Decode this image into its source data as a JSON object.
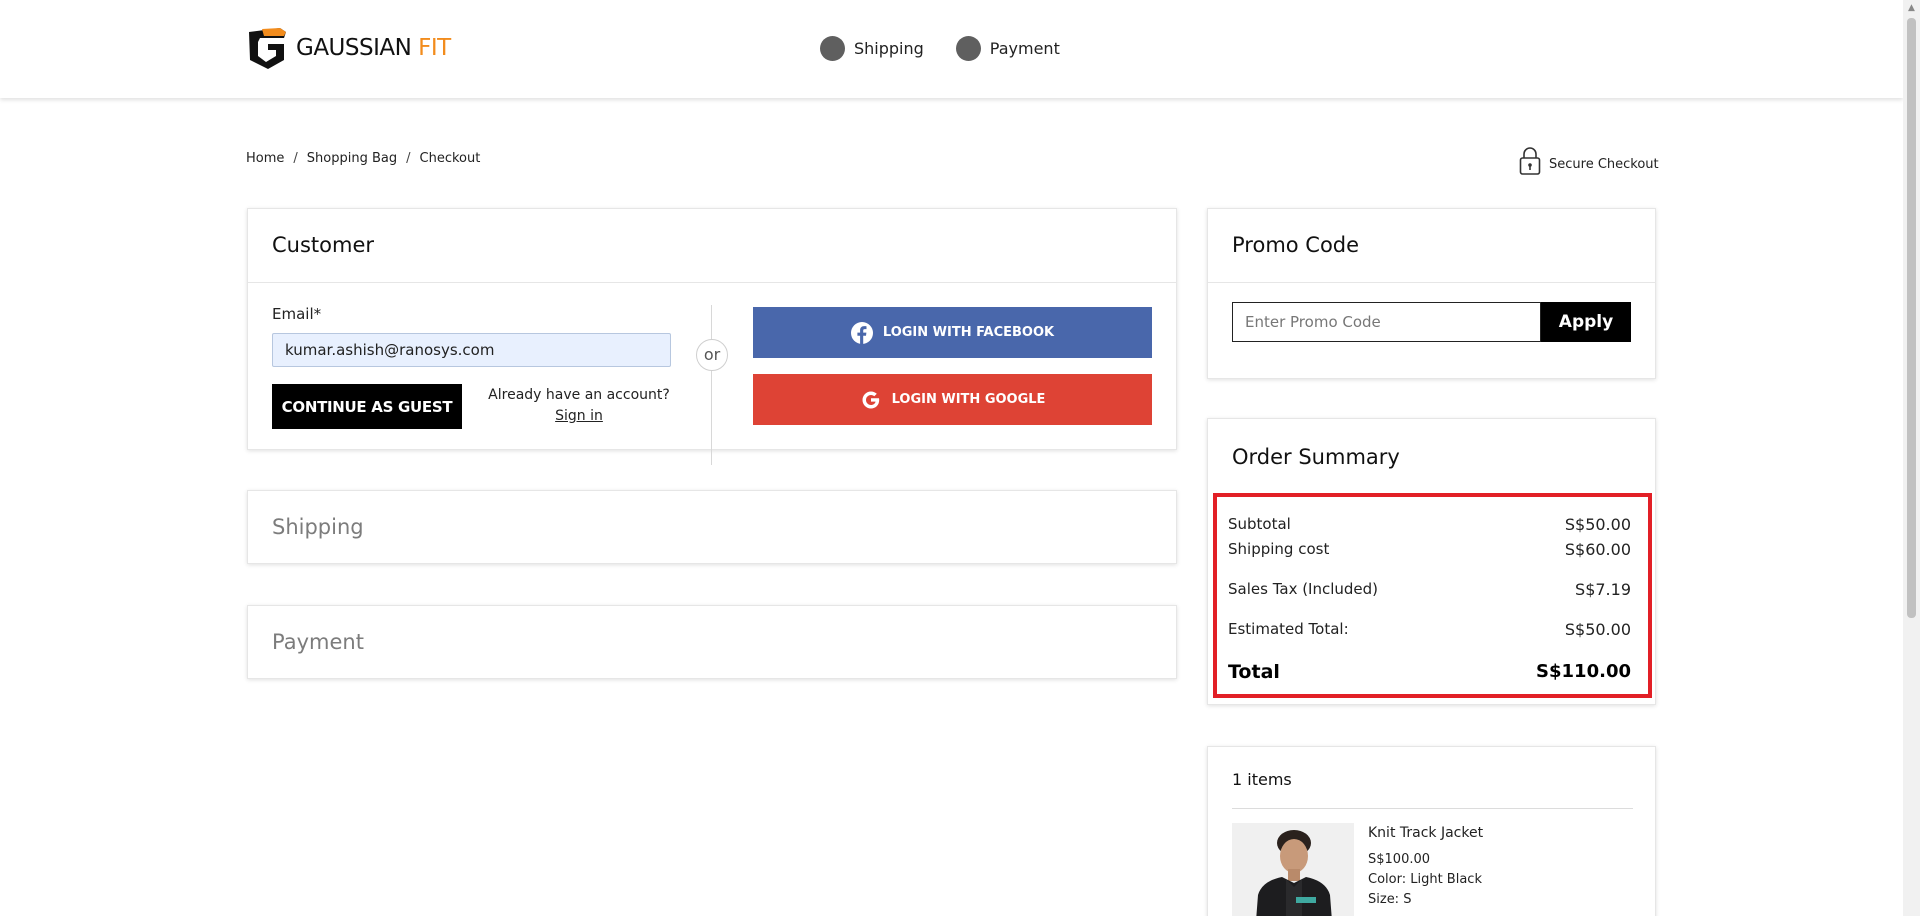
{
  "header": {
    "logo_text_main": "GAUSSIAN",
    "logo_text_accent": "FIT",
    "steps": [
      {
        "label": "Shipping"
      },
      {
        "label": "Payment"
      }
    ]
  },
  "breadcrumb": {
    "items": [
      "Home",
      "Shopping Bag",
      "Checkout"
    ],
    "separator": "/"
  },
  "secure": {
    "label": "Secure Checkout",
    "icon": "lock-icon"
  },
  "customer": {
    "title": "Customer",
    "email_label": "Email*",
    "email_value": "kumar.ashish@ranosys.com",
    "guest_button": "CONTINUE AS GUEST",
    "have_account": "Already have an account?",
    "sign_in": "Sign in",
    "or": "or",
    "facebook_button": "LOGIN WITH FACEBOOK",
    "google_button": "LOGIN WITH GOOGLE"
  },
  "shipping": {
    "title": "Shipping"
  },
  "payment": {
    "title": "Payment"
  },
  "promo": {
    "title": "Promo Code",
    "placeholder": "Enter Promo Code",
    "apply": "Apply"
  },
  "summary": {
    "title": "Order Summary",
    "rows": [
      {
        "label": "Subtotal",
        "value": "S$50.00"
      },
      {
        "label": "Shipping cost",
        "value": "S$60.00"
      },
      {
        "label": "Sales Tax (Included)",
        "value": "S$7.19"
      },
      {
        "label": "Estimated Total:",
        "value": "S$50.00"
      }
    ],
    "total_label": "Total",
    "total_value": "S$110.00"
  },
  "items": {
    "count_label": "1 items",
    "products": [
      {
        "name": "Knit Track Jacket",
        "price": "S$100.00",
        "color": "Color: Light Black",
        "size": "Size: S"
      }
    ]
  },
  "colors": {
    "accent": "#f28c1d",
    "facebook": "#4967ab",
    "google": "#de4335",
    "highlight": "#e21f26"
  }
}
